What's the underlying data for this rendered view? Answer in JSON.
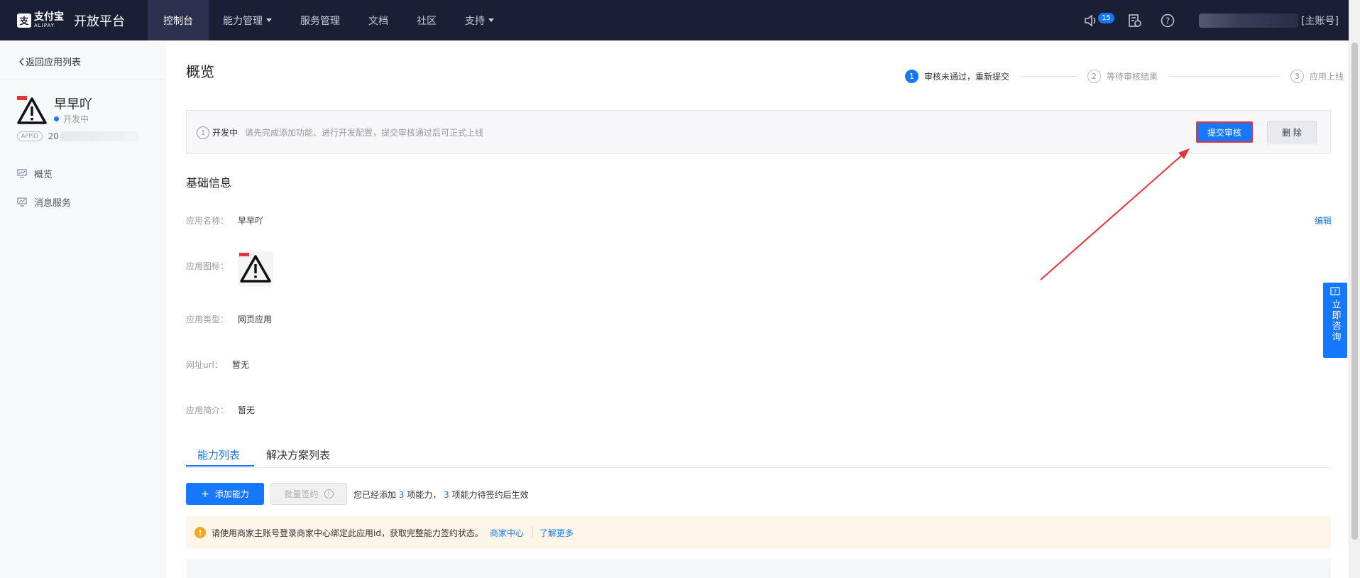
{
  "header": {
    "brand_cn": "支付宝",
    "brand_en": "ALIPAY",
    "platform": "开放平台",
    "nav": [
      {
        "label": "控制台",
        "active": true
      },
      {
        "label": "能力管理",
        "dropdown": true
      },
      {
        "label": "服务管理"
      },
      {
        "label": "文档"
      },
      {
        "label": "社区"
      },
      {
        "label": "支持",
        "dropdown": true
      }
    ],
    "notification_count": "15",
    "account_suffix": "[主账号]"
  },
  "sidebar": {
    "back_label": "返回应用列表",
    "app_name": "早早吖",
    "app_status": "开发中",
    "appid_tag": "APPID",
    "appid_prefix": "20",
    "items": [
      {
        "label": "概览",
        "icon": "monitor-icon"
      },
      {
        "label": "消息服务",
        "icon": "monitor-icon"
      }
    ]
  },
  "main": {
    "title": "概览",
    "steps": [
      {
        "num": "1",
        "label": "审核未通过，重新提交",
        "active": true
      },
      {
        "num": "2",
        "label": "等待审核结果"
      },
      {
        "num": "3",
        "label": "应用上线"
      }
    ],
    "notice": {
      "icon": "1",
      "status": "开发中",
      "desc": "请先完成添加功能、进行开发配置，提交审核通过后可正式上线",
      "submit_label": "提交审核",
      "delete_label": "删 除"
    },
    "basic_info": {
      "title": "基础信息",
      "edit_label": "编辑",
      "fields": [
        {
          "label": "应用名称：",
          "value": "早早吖"
        },
        {
          "label": "应用图标：",
          "value": ""
        },
        {
          "label": "应用类型：",
          "value": "网页应用"
        },
        {
          "label": "网址url：",
          "value": "暂无"
        },
        {
          "label": "应用简介：",
          "value": "暂无"
        }
      ]
    },
    "tabs": [
      {
        "label": "能力列表",
        "active": true
      },
      {
        "label": "解决方案列表"
      }
    ],
    "actions": {
      "add_label": "添加能力",
      "batch_label": "批量签约",
      "summary_pre": "您已经添加",
      "added_count": "3",
      "summary_mid": "项能力，",
      "pending_count": "3",
      "summary_post": "项能力待签约后生效"
    },
    "alert": {
      "text": "请使用商家主账号登录商家中心绑定此应用id，获取完整能力签约状态。",
      "link1": "商家中心",
      "link2": "了解更多"
    }
  },
  "consult": {
    "label": "立即咨询"
  },
  "colors": {
    "topbar": "#1a1f36",
    "primary": "#1677ff",
    "annotation": "#e8333b",
    "alert_bg": "#fdf6e8"
  }
}
